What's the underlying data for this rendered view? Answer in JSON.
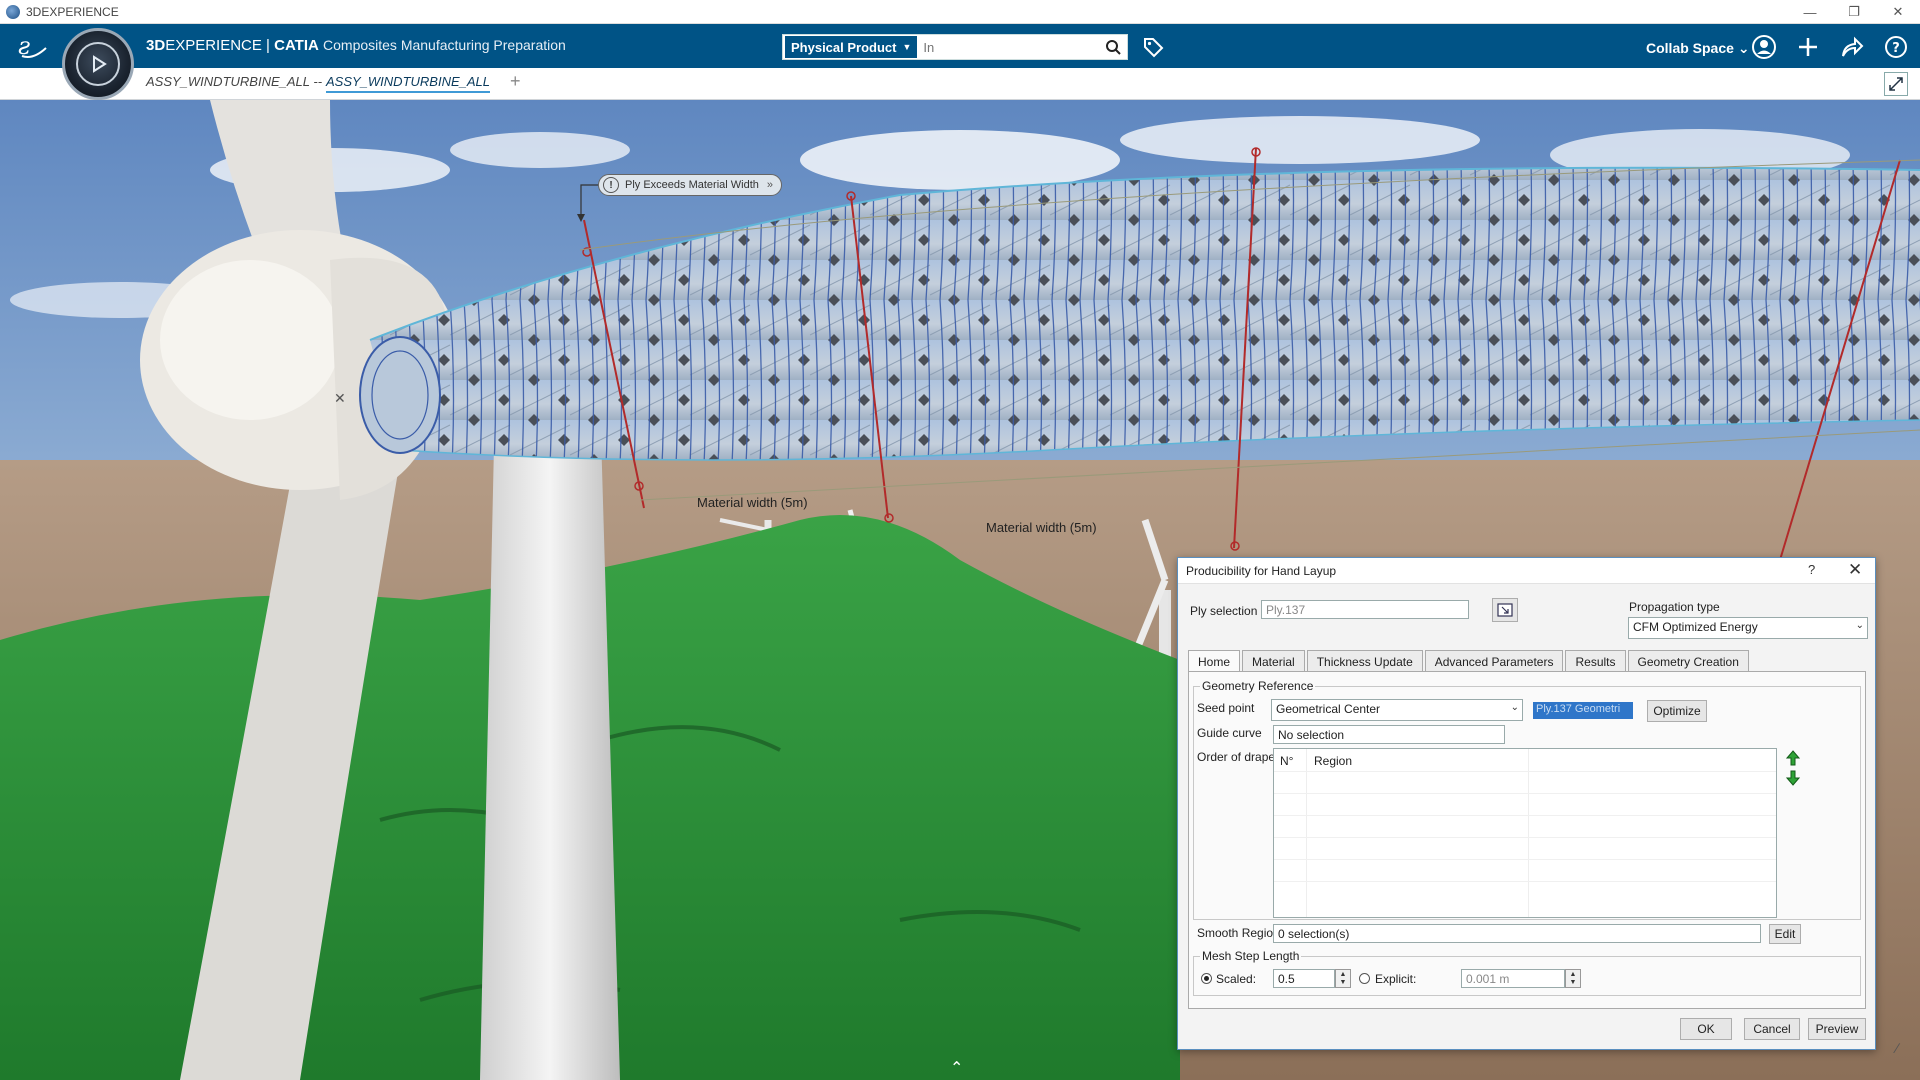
{
  "os": {
    "app_name": "3DEXPERIENCE"
  },
  "header": {
    "brand_bold": "3D",
    "brand_regular": "EXPERIENCE",
    "brand_separator": " | ",
    "brand_catia": "CATIA",
    "app_name": "Composites Manufacturing Preparation",
    "search_scope": "Physical Product",
    "search_placeholder": "In",
    "collab_space": "Collab Space"
  },
  "tabs": {
    "doc1": "ASSY_WINDTURBINE_ALL --",
    "doc2": "ASSY_WINDTURBINE_ALL"
  },
  "viewport": {
    "callout": "Ply Exceeds Material Width",
    "label1": "Material width (5m)",
    "label2": "Material width (5m)"
  },
  "dialog": {
    "title": "Producibility for Hand Layup",
    "help": "?",
    "ply_selection_label": "Ply selection",
    "ply_selection_value": "Ply.137",
    "propagation_label": "Propagation type",
    "propagation_value": "CFM Optimized Energy",
    "tabs": [
      "Home",
      "Material",
      "Thickness Update",
      "Advanced Parameters",
      "Results",
      "Geometry Creation"
    ],
    "geometry_reference": "Geometry Reference",
    "seed_point_label": "Seed point",
    "seed_point_value": "Geometrical Center",
    "seed_point_selected": "Ply.137 Geometri",
    "optimize": "Optimize",
    "guide_curve_label": "Guide curve",
    "guide_curve_value": "No selection",
    "order_of_drape_label": "Order of drape",
    "col_number": "N°",
    "col_region": "Region",
    "smooth_regions_label": "Smooth Regions",
    "smooth_regions_value": "0 selection(s)",
    "edit": "Edit",
    "mesh_step_length": "Mesh Step Length",
    "scaled_label": "Scaled:",
    "scaled_value": "0.5",
    "explicit_label": "Explicit:",
    "explicit_value": "0.001 m",
    "ok": "OK",
    "cancel": "Cancel",
    "preview": "Preview"
  },
  "colors": {
    "header_bg": "#005386",
    "dialog_border": "#5a8fbf",
    "ply_blue": "#3a5ca8",
    "cut_line": "#b22a2a",
    "hill_green": "#2f9a3c"
  }
}
